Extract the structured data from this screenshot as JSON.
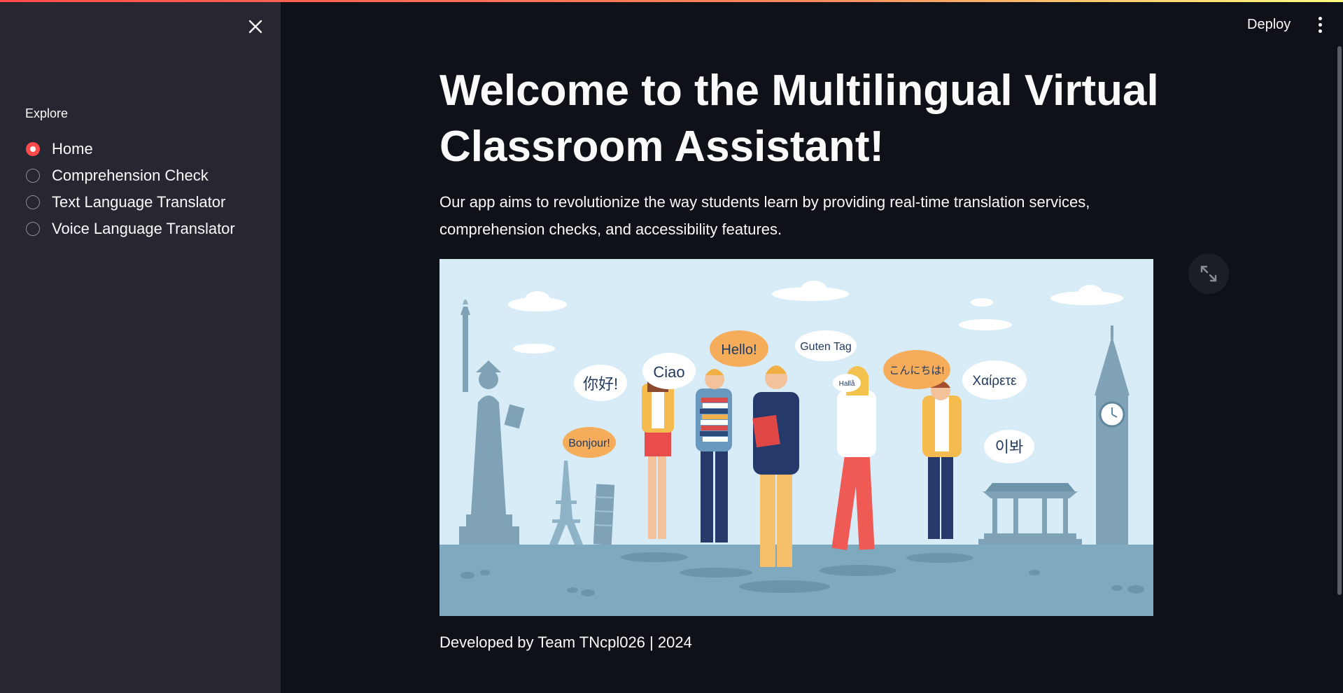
{
  "sidebar": {
    "close_icon": "close-icon",
    "nav_label": "Explore",
    "items": [
      {
        "label": "Home",
        "selected": true
      },
      {
        "label": "Comprehension Check",
        "selected": false
      },
      {
        "label": "Text Language Translator",
        "selected": false
      },
      {
        "label": "Voice Language Translator",
        "selected": false
      }
    ]
  },
  "header": {
    "deploy_label": "Deploy",
    "menu_icon": "more-vertical-icon"
  },
  "main": {
    "title": "Welcome to the Multilingual Virtual Classroom Assistant!",
    "intro": "Our app aims to revolutionize the way students learn by providing real-time translation services, comprehension checks, and accessibility features.",
    "image": {
      "speech_bubbles": [
        "你好!",
        "Ciao",
        "Hello!",
        "Guten Tag",
        "Hallå",
        "こんにちは!",
        "Χαίρετε",
        "Bonjour!",
        "이봐"
      ]
    },
    "expand_icon": "expand-icon",
    "footer": "Developed by Team TNcpl026 | 2024"
  },
  "colors": {
    "accent": "#ff4b4b",
    "background": "#0e1117",
    "sidebar_background": "#262730",
    "text": "#fafafa"
  }
}
